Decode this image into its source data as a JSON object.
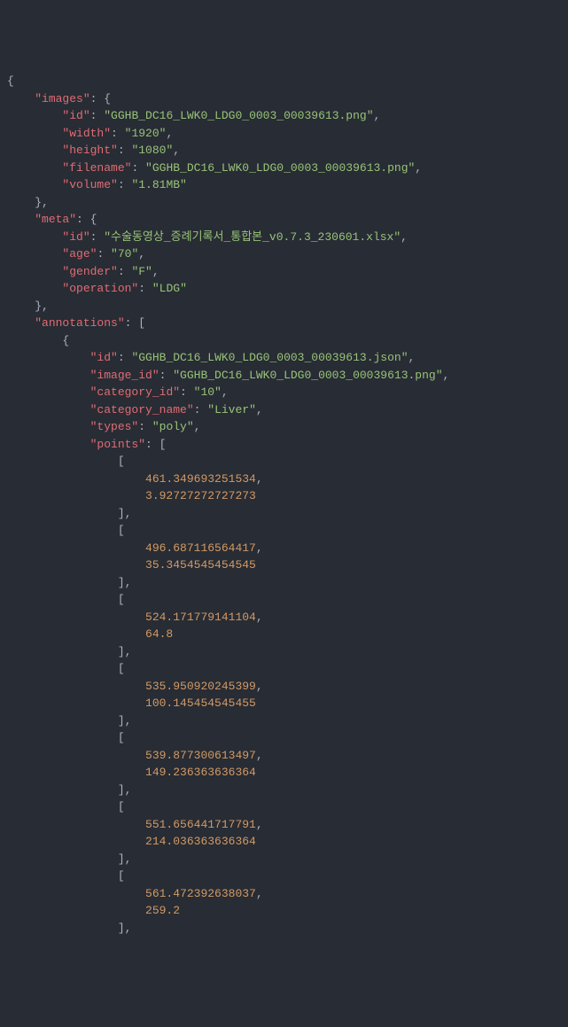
{
  "json": {
    "images": {
      "id": "GGHB_DC16_LWK0_LDG0_0003_00039613.png",
      "width": "1920",
      "height": "1080",
      "filename": "GGHB_DC16_LWK0_LDG0_0003_00039613.png",
      "volume": "1.81MB"
    },
    "meta": {
      "id": "수술동영상_증례기록서_통합본_v0.7.3_230601.xlsx",
      "age": "70",
      "gender": "F",
      "operation": "LDG"
    },
    "annotations": [
      {
        "id": "GGHB_DC16_LWK0_LDG0_0003_00039613.json",
        "image_id": "GGHB_DC16_LWK0_LDG0_0003_00039613.png",
        "category_id": "10",
        "category_name": "Liver",
        "types": "poly",
        "points": [
          [
            461.349693251534,
            3.92727272727273
          ],
          [
            496.687116564417,
            35.3454545454545
          ],
          [
            524.171779141104,
            64.8
          ],
          [
            535.950920245399,
            100.145454545455
          ],
          [
            539.877300613497,
            149.236363636364
          ],
          [
            551.656441717791,
            214.036363636364
          ],
          [
            561.472392638037,
            259.2
          ]
        ]
      }
    ]
  },
  "labels": {
    "images": "images",
    "images_id": "id",
    "images_width": "width",
    "images_height": "height",
    "images_filename": "filename",
    "images_volume": "volume",
    "meta": "meta",
    "meta_id": "id",
    "meta_age": "age",
    "meta_gender": "gender",
    "meta_operation": "operation",
    "annotations": "annotations",
    "ann_id": "id",
    "ann_image_id": "image_id",
    "ann_category_id": "category_id",
    "ann_category_name": "category_name",
    "ann_types": "types",
    "ann_points": "points"
  }
}
